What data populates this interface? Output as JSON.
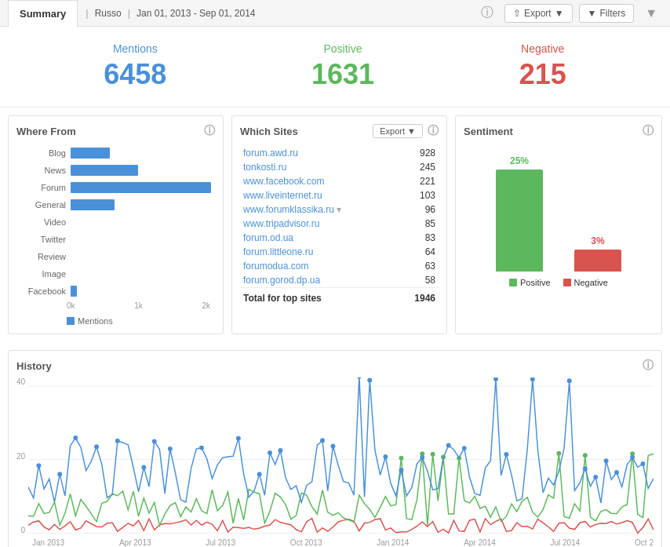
{
  "header": {
    "tab_label": "Summary",
    "entity": "Russo",
    "date_range": "Jan 01, 2013 - Sep 01, 2014",
    "export_label": "Export",
    "filters_label": "Filters"
  },
  "metrics": {
    "mentions_label": "Mentions",
    "mentions_value": "6458",
    "positive_label": "Positive",
    "positive_value": "1631",
    "negative_label": "Negative",
    "negative_value": "215"
  },
  "where_from": {
    "title": "Where From",
    "legend_label": "Mentions",
    "bars": [
      {
        "label": "Blog",
        "value": 75,
        "max": 270
      },
      {
        "label": "News",
        "value": 130,
        "max": 270
      },
      {
        "label": "Forum",
        "value": 270,
        "max": 270
      },
      {
        "label": "General",
        "value": 85,
        "max": 270
      },
      {
        "label": "Video",
        "value": 0,
        "max": 270
      },
      {
        "label": "Twitter",
        "value": 0,
        "max": 270
      },
      {
        "label": "Review",
        "value": 0,
        "max": 270
      },
      {
        "label": "Image",
        "value": 0,
        "max": 270
      },
      {
        "label": "Facebook",
        "value": 12,
        "max": 270
      }
    ],
    "axis": [
      "0k",
      "1k",
      "2k"
    ]
  },
  "which_sites": {
    "title": "Which Sites",
    "export_label": "Export",
    "sites": [
      {
        "name": "forum.awd.ru",
        "count": "928"
      },
      {
        "name": "tonkosti.ru",
        "count": "245"
      },
      {
        "name": "www.facebook.com",
        "count": "221"
      },
      {
        "name": "www.liveinternet.ru",
        "count": "103"
      },
      {
        "name": "www.forumklassika.ru",
        "count": "96",
        "has_more": true
      },
      {
        "name": "www.tripadvisor.ru",
        "count": "85"
      },
      {
        "name": "forum.od.ua",
        "count": "83"
      },
      {
        "name": "forum.littleone.ru",
        "count": "64"
      },
      {
        "name": "forumodua.com",
        "count": "63"
      },
      {
        "name": "forum.gorod.dp.ua",
        "count": "58"
      }
    ],
    "total_label": "Total for top sites",
    "total_value": "1946"
  },
  "sentiment": {
    "title": "Sentiment",
    "positive_pct": "25%",
    "negative_pct": "3%",
    "positive_bar_height": 130,
    "negative_bar_height": 28,
    "positive_label": "Positive",
    "negative_label": "Negative"
  },
  "history": {
    "title": "History",
    "y_labels": [
      "40",
      "20",
      "0"
    ],
    "x_labels": [
      "Jan 2013",
      "Apr 2013",
      "Jul 2013",
      "Oct 2013",
      "Jan 2014",
      "Apr 2014",
      "Jul 2014",
      "Oct 2"
    ]
  }
}
